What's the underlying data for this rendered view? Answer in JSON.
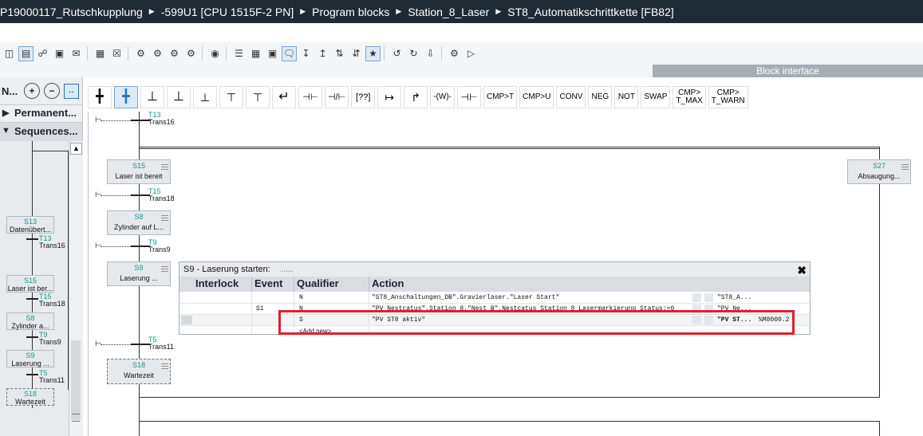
{
  "title": {
    "crumbs": [
      "P19000117_Rutschkupplung",
      "-599U1 [CPU 1515F-2 PN]",
      "Program blocks",
      "Station_8_Laser",
      "ST8_Automatikschrittkette [FB82]"
    ]
  },
  "block_interface_label": "Block interface",
  "left_pane": {
    "header": "N...",
    "permanent_label": "Permanent...",
    "sequences_label": "Sequences...",
    "overview_steps": [
      {
        "num": "S13",
        "name": "Datenübert..."
      },
      {
        "num": "S15",
        "name": "Laser ist ber..."
      },
      {
        "num": "S8",
        "name": "Zylinder a..."
      },
      {
        "num": "S9",
        "name": "Laserung ..."
      },
      {
        "num": "S18",
        "name": "Wartezeit"
      }
    ],
    "overview_transitions": [
      {
        "num": "T13",
        "name": "Trans16"
      },
      {
        "num": "T15",
        "name": "Trans18"
      },
      {
        "num": "T9",
        "name": "Trans9"
      },
      {
        "num": "T5",
        "name": "Trans11"
      }
    ]
  },
  "ladder_toolbar": {
    "text_buttons": [
      "CMP>T",
      "CMP>U",
      "CONV",
      "NEG",
      "NOT",
      "SWAP",
      "CMP>\nT_MAX",
      "CMP>\nT_WARN"
    ]
  },
  "graph": {
    "steps": [
      {
        "num": "S15",
        "name": "Laser ist bereit"
      },
      {
        "num": "S8",
        "name": "Zylinder auf L..."
      },
      {
        "num": "S9",
        "name": "Laserung ..."
      },
      {
        "num": "S18",
        "name": "Wartezeit"
      },
      {
        "num": "S27",
        "name": "Absaugung..."
      }
    ],
    "transitions": [
      {
        "num": "T13",
        "name": "Trans16"
      },
      {
        "num": "T15",
        "name": "Trans18"
      },
      {
        "num": "T9",
        "name": "Trans9"
      },
      {
        "num": "T5",
        "name": "Trans11"
      }
    ]
  },
  "action_panel": {
    "title": "S9 - Laserung starten:",
    "title_dots": ".....",
    "columns": [
      "Interlock",
      "Event",
      "Qualifier",
      "Action"
    ],
    "rows": [
      {
        "event": "",
        "qualifier": "N",
        "action": "\"ST8_Anschaltungen_DB\".Gravierlaser.\"Laser Start\"",
        "ref": "\"ST8_A...",
        "addr": ""
      },
      {
        "event": "S1",
        "qualifier": "N",
        "action": "\"PV_Nestcatus\".Station_8.\"Nest_B\".Nestcatus_Station_8_Lasermarkierung_Status:=0",
        "ref": "\"PV_Ne...",
        "addr": ""
      },
      {
        "event": "",
        "qualifier": "S",
        "action": "\"PV ST8 aktiv\"",
        "ref": "\"PV ST...",
        "addr": "%M8000.2"
      },
      {
        "event": "",
        "qualifier": "<Add new>",
        "action": "",
        "ref": "",
        "addr": ""
      }
    ]
  },
  "colors": {
    "titlebar": "#1e2b35",
    "highlight": "#e0202a",
    "step_number": "#1a8f8f"
  }
}
